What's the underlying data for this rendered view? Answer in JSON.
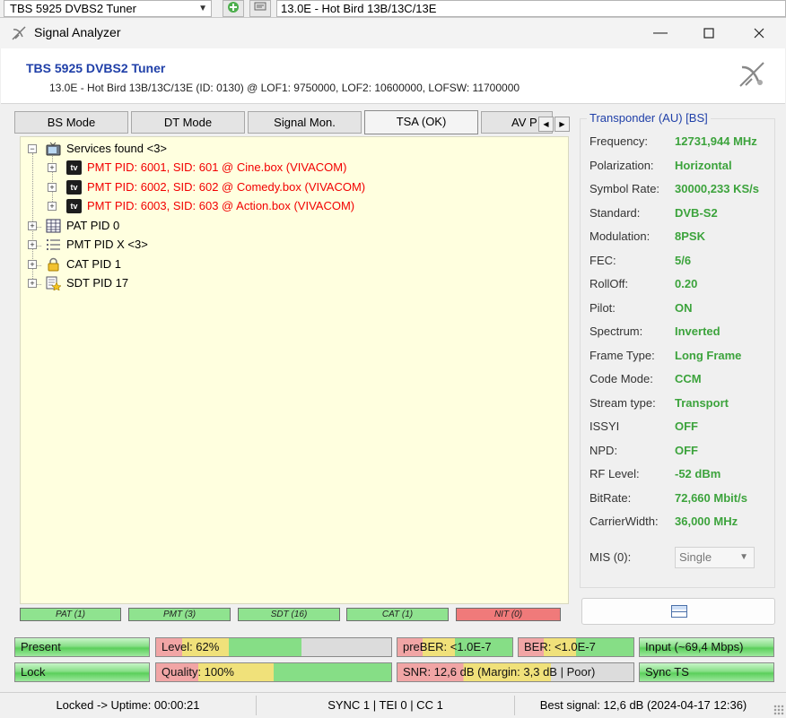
{
  "toolbar": {
    "tuner_select": "TBS 5925 DVBS2 Tuner",
    "satellite": "13.0E - Hot Bird 13B/13C/13E"
  },
  "window": {
    "title": "Signal Analyzer"
  },
  "header": {
    "tuner_name": "TBS 5925 DVBS2 Tuner",
    "details": "13.0E - Hot Bird 13B/13C/13E (ID: 0130) @ LOF1: 9750000, LOF2: 10600000, LOFSW: 11700000"
  },
  "tabs": [
    {
      "label": "BS Mode"
    },
    {
      "label": "DT Mode"
    },
    {
      "label": "Signal Mon."
    },
    {
      "label": "TSA (OK)"
    },
    {
      "label": "AV P"
    }
  ],
  "tree": {
    "services_root": "Services found <3>",
    "services": [
      "PMT PID: 6001, SID: 601 @ Cine.box (VIVACOM)",
      "PMT PID: 6002, SID: 602 @ Comedy.box (VIVACOM)",
      "PMT PID: 6003, SID: 603 @ Action.box (VIVACOM)"
    ],
    "pat": "PAT PID 0",
    "pmt": "PMT PID X <3>",
    "cat": "CAT PID 1",
    "sdt": "SDT PID 17",
    "tv_badge": "tv"
  },
  "pid_bars": [
    {
      "label": "PAT (1)",
      "status": "ok"
    },
    {
      "label": "PMT (3)",
      "status": "ok"
    },
    {
      "label": "SDT (16)",
      "status": "ok"
    },
    {
      "label": "CAT (1)",
      "status": "ok"
    },
    {
      "label": "NIT (0)",
      "status": "error"
    }
  ],
  "transponder": {
    "title": "Transponder (AU) [BS]",
    "rows": [
      {
        "key": "Frequency:",
        "value": "12731,944 MHz"
      },
      {
        "key": "Polarization:",
        "value": "Horizontal"
      },
      {
        "key": "Symbol Rate:",
        "value": "30000,233 KS/s"
      },
      {
        "key": "Standard:",
        "value": "DVB-S2"
      },
      {
        "key": "Modulation:",
        "value": "8PSK"
      },
      {
        "key": "FEC:",
        "value": "5/6"
      },
      {
        "key": "RollOff:",
        "value": "0.20"
      },
      {
        "key": "Pilot:",
        "value": "ON"
      },
      {
        "key": "Spectrum:",
        "value": "Inverted"
      },
      {
        "key": "Frame Type:",
        "value": "Long Frame"
      },
      {
        "key": "Code Mode:",
        "value": "CCM"
      },
      {
        "key": "Stream type:",
        "value": "Transport"
      },
      {
        "key": "ISSYI",
        "value": "OFF"
      },
      {
        "key": "NPD:",
        "value": "OFF"
      },
      {
        "key": "RF Level:",
        "value": "-52 dBm"
      },
      {
        "key": "BitRate:",
        "value": "72,660 Mbit/s"
      },
      {
        "key": "CarrierWidth:",
        "value": "36,000 MHz"
      }
    ],
    "mis_label": "MIS (0):",
    "mis_value": "Single"
  },
  "meters": {
    "present": "Present",
    "level": "Level: 62%",
    "level_value": 0.62,
    "preber": "preBER: <1.0E-7",
    "ber": "BER: <1.0E-7",
    "input": "Input (~69,4 Mbps)",
    "lock": "Lock",
    "quality": "Quality: 100%",
    "quality_value": 1.0,
    "snr": "SNR: 12,6 dB (Margin: 3,3 dB | Poor)",
    "sync": "Sync TS"
  },
  "status": {
    "uptime": "Locked -> Uptime: 00:00:21",
    "sync": "SYNC 1 | TEI 0 | CC 1",
    "best": "Best signal: 12,6 dB (2024-04-17 12:36)"
  }
}
